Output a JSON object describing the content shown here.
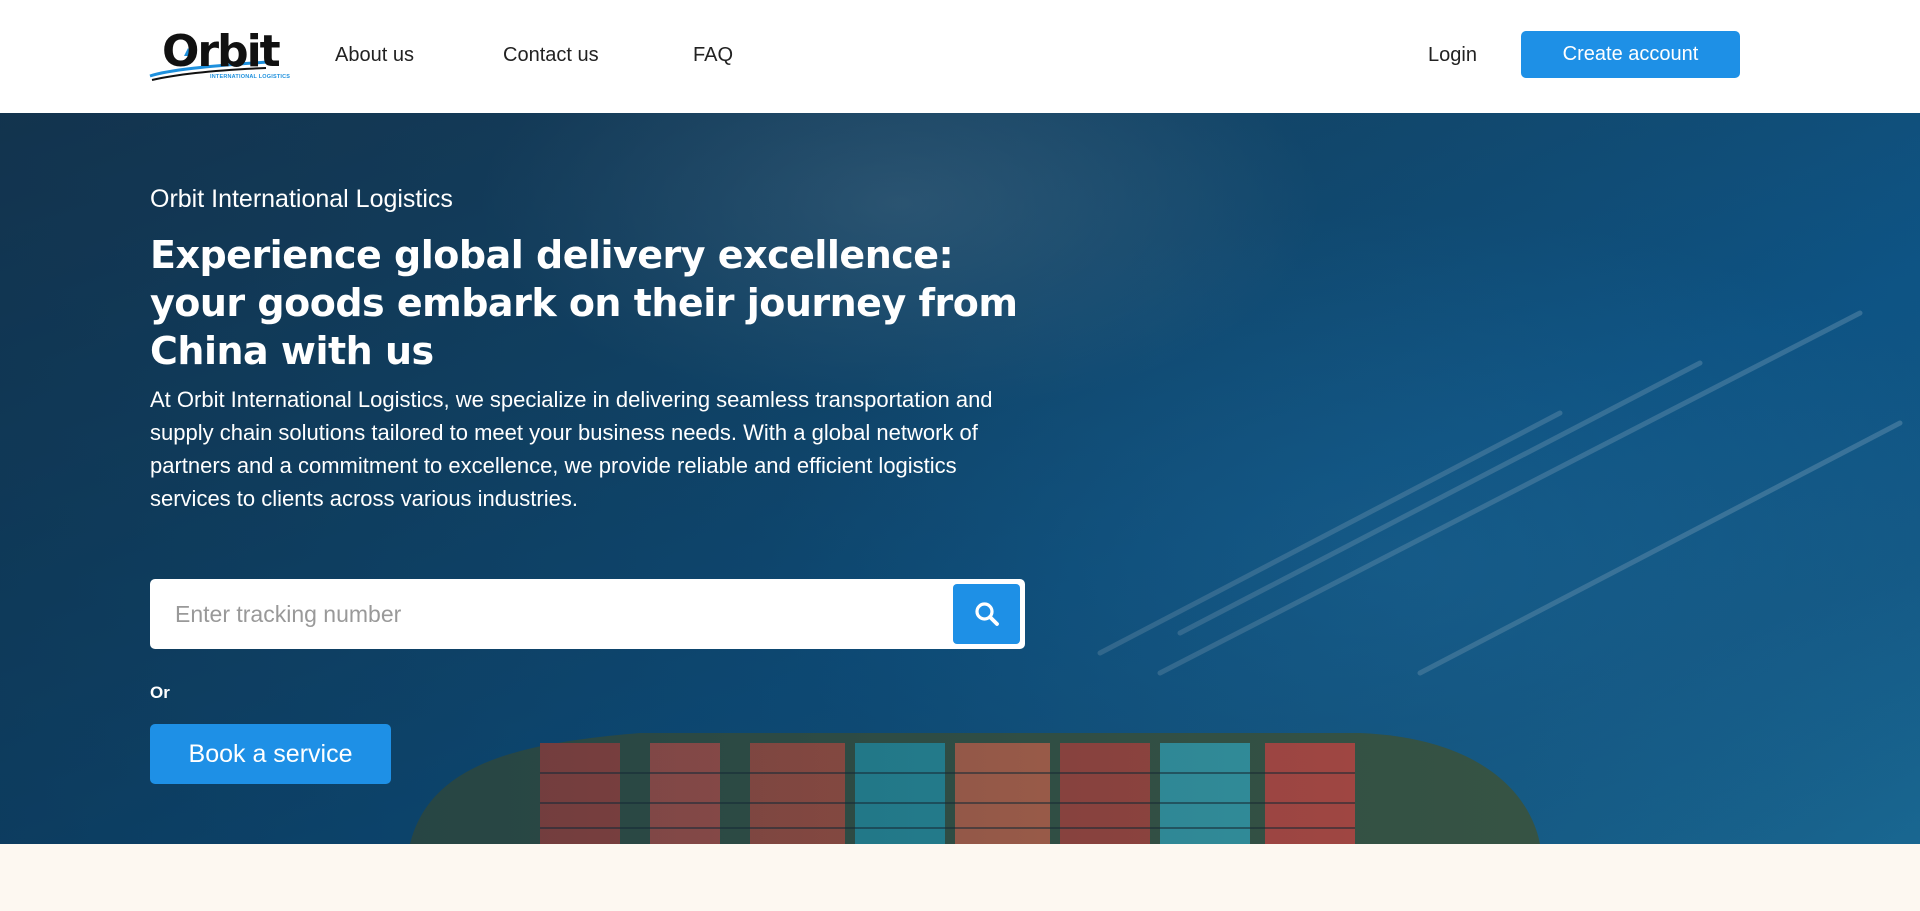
{
  "header": {
    "logo_text": "Orbit",
    "logo_subtext": "INTERNATIONAL LOGISTICS",
    "nav": [
      {
        "label": "About us"
      },
      {
        "label": "Contact us"
      },
      {
        "label": "FAQ"
      }
    ],
    "login_label": "Login",
    "create_account_label": "Create account"
  },
  "hero": {
    "eyebrow": "Orbit International Logistics",
    "headline": "Experience global delivery excellence: your goods embark on their journey from China with us",
    "intro": "At Orbit International Logistics, we specialize in delivering seamless transportation and supply chain solutions tailored to meet your business needs. With a global network of partners and a commitment to excellence, we provide reliable and efficient logistics services to clients across various industries.",
    "search": {
      "placeholder": "Enter tracking number",
      "value": "",
      "button_icon": "search-icon"
    },
    "or_label": "Or",
    "book_label": "Book a service",
    "background_image": "aerial-container-ship-ocean"
  },
  "colors": {
    "accent": "#1e90e6",
    "header_bg": "#ffffff",
    "hero_overlay": "#134d74",
    "page_bg": "#fdf8f1"
  }
}
